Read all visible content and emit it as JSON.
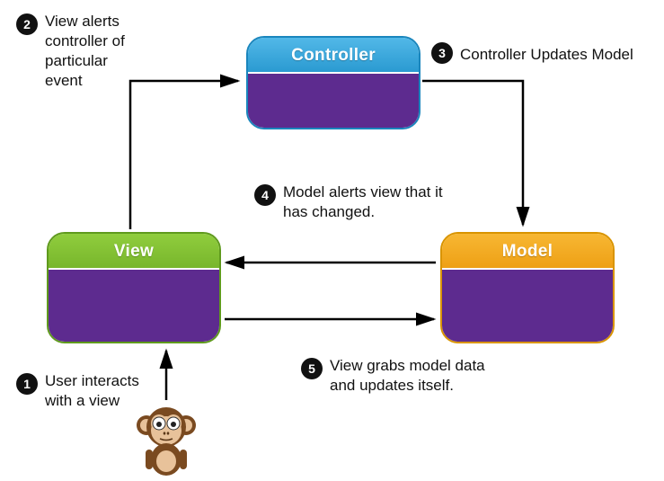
{
  "nodes": {
    "controller": {
      "label": "Controller"
    },
    "view": {
      "label": "View"
    },
    "model": {
      "label": "Model"
    }
  },
  "steps": {
    "s1": {
      "num": "1",
      "text": "User interacts with a view"
    },
    "s2": {
      "num": "2",
      "text": "View alerts controller of particular event"
    },
    "s3": {
      "num": "3",
      "text": "Controller Updates Model"
    },
    "s4": {
      "num": "4",
      "text": "Model alerts view that it has changed."
    },
    "s5": {
      "num": "5",
      "text": "View grabs model data and updates itself."
    }
  },
  "actor": {
    "name": "user-monkey"
  }
}
